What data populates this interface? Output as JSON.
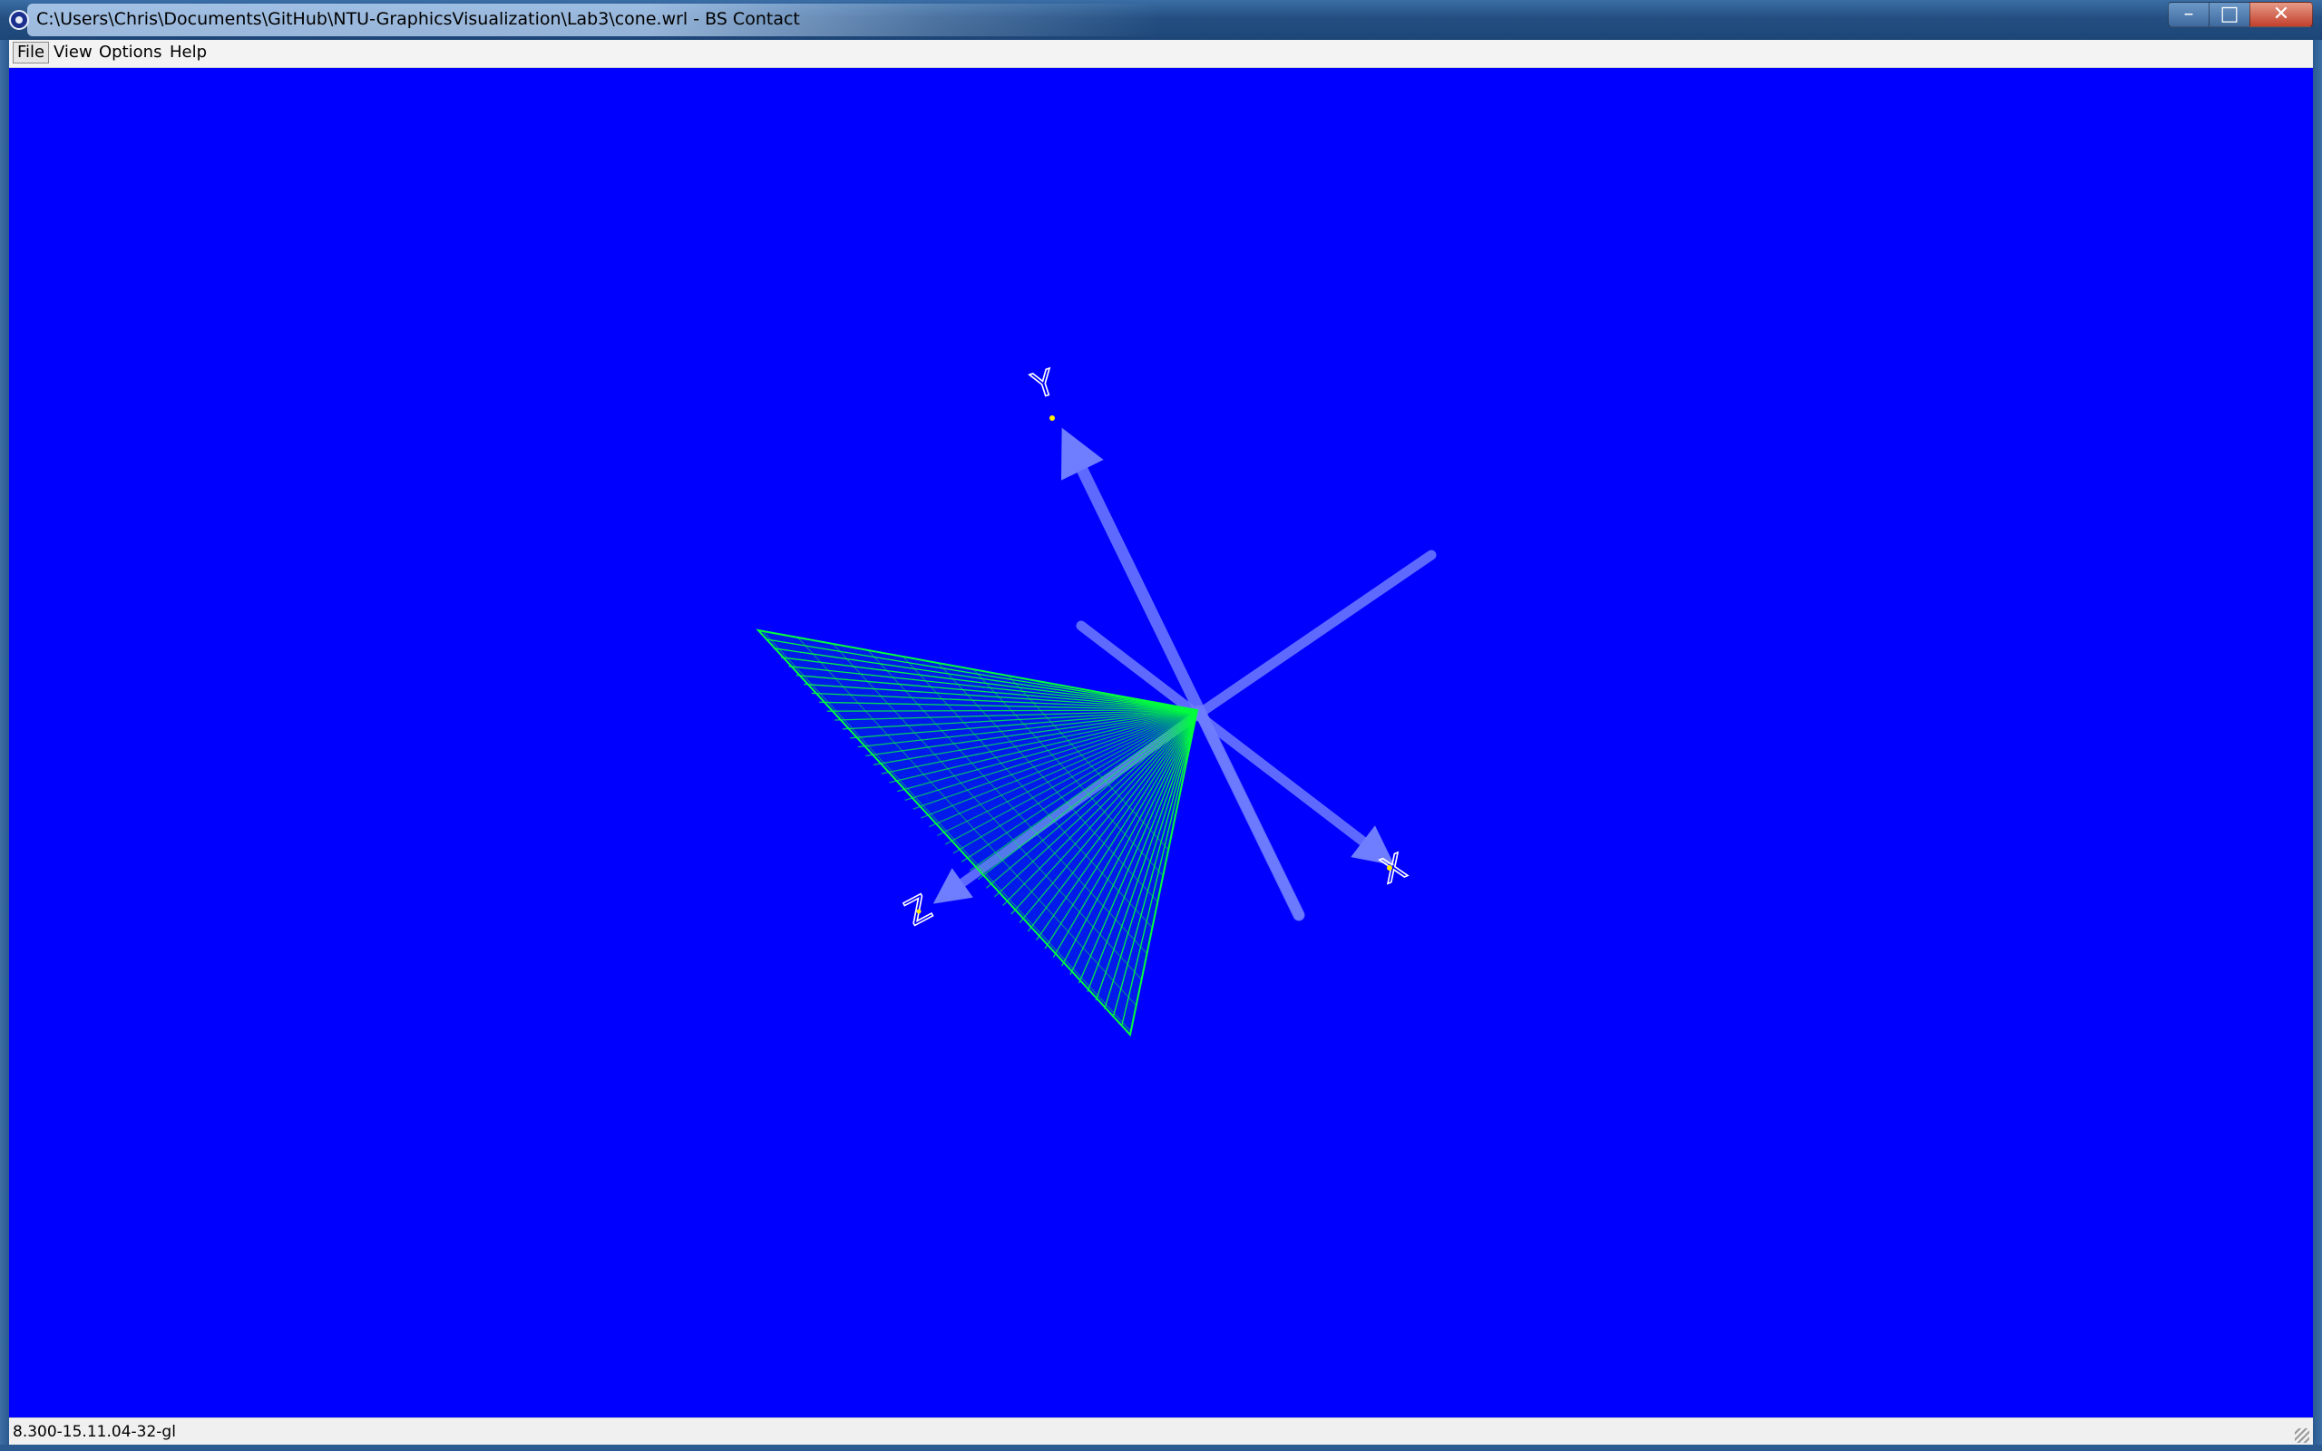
{
  "window": {
    "title": "C:\\Users\\Chris\\Documents\\GitHub\\NTU-GraphicsVisualization\\Lab3\\cone.wrl - BS Contact",
    "minimize_glyph": "–",
    "maximize_glyph": "□",
    "close_glyph": "✕"
  },
  "menu": {
    "items": [
      {
        "label": "File"
      },
      {
        "label": "View"
      },
      {
        "label": "Options"
      },
      {
        "label": "Help"
      }
    ]
  },
  "scene": {
    "background_color": "#0000ff",
    "cone_color": "#00ff3c",
    "axis_color": "#6f7dff",
    "axis_labels": {
      "x": "X",
      "y": "Y",
      "z": "Z"
    }
  },
  "status": {
    "text": "8.300-15.11.04-32-gl"
  }
}
